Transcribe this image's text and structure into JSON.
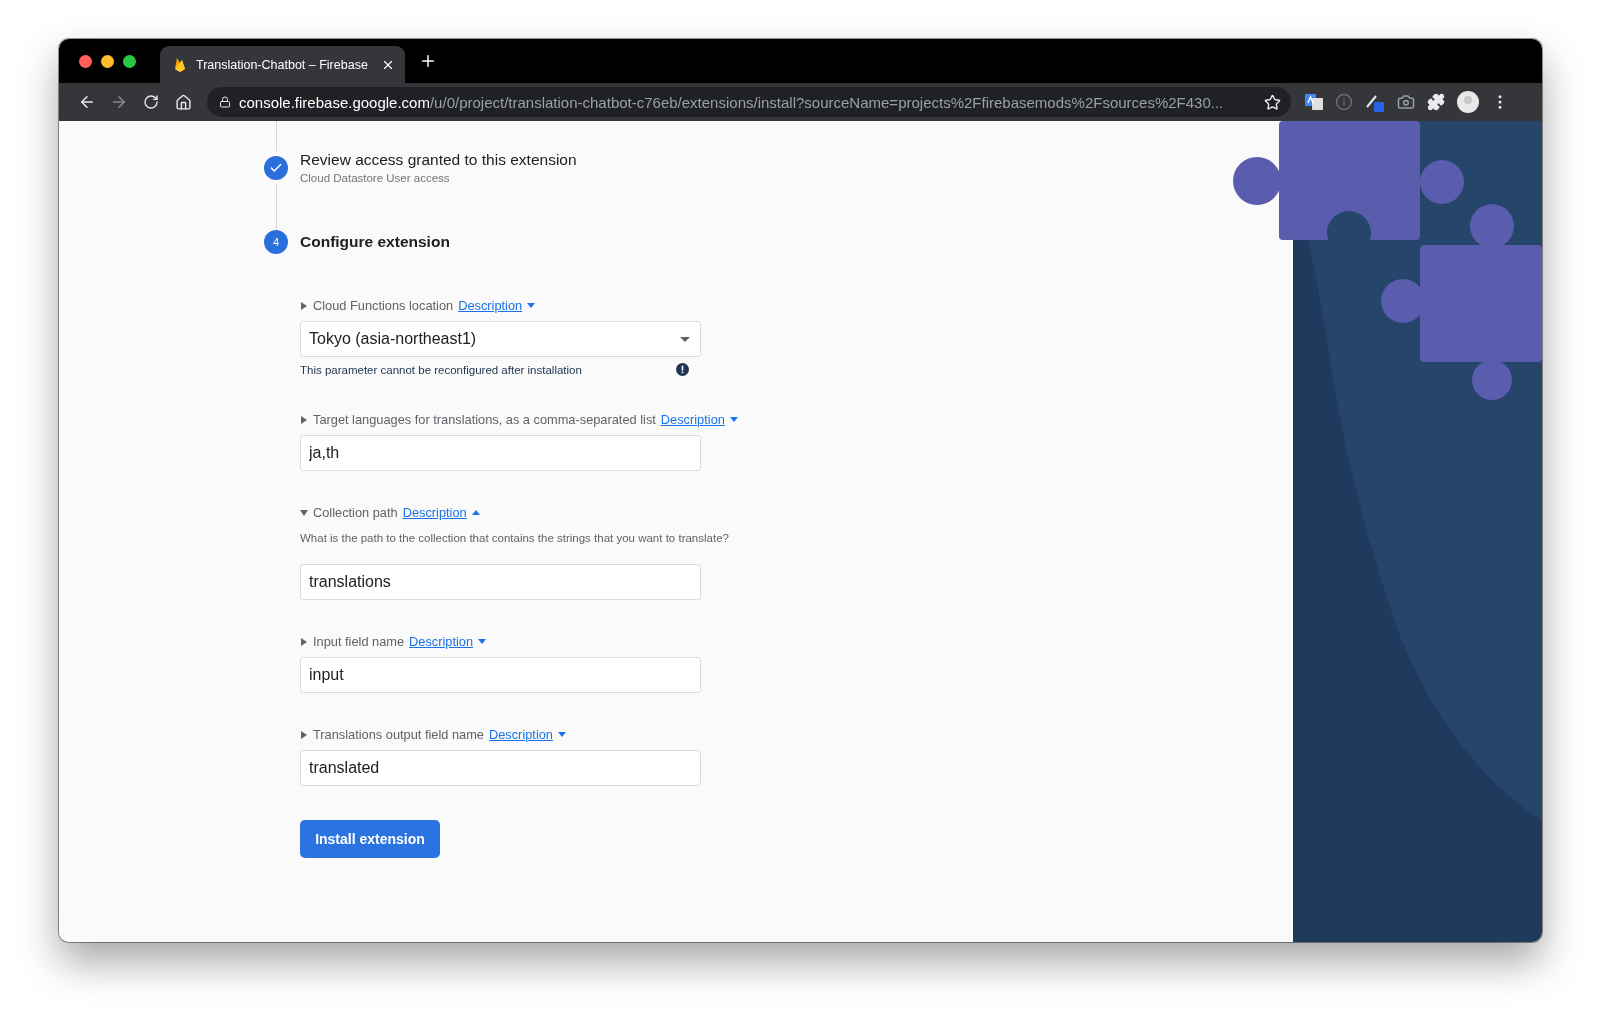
{
  "browser": {
    "tabs": [
      {
        "title": "Translation-Chatbot – Firebase",
        "selected": true
      }
    ],
    "nav": [
      {
        "kind": "back",
        "disabled": false
      },
      {
        "kind": "forward",
        "disabled": true
      },
      {
        "kind": "reload",
        "disabled": false
      },
      {
        "kind": "home",
        "disabled": false
      }
    ],
    "address": {
      "host": "console.firebase.google.com",
      "path": "/u/0/project/translation-chatbot-c76eb/extensions/install?sourceName=projects%2Ffirebasemods%2Fsources%2F430..."
    }
  },
  "steps": [
    {
      "completed": true,
      "title": "Review access granted to this extension",
      "subtitle": "Cloud Datastore User access"
    },
    {
      "completed": false,
      "number": "4",
      "title": "Configure extension"
    }
  ],
  "params": [
    {
      "kind": "select",
      "label": "Cloud Functions location",
      "link": "Description",
      "expanded": false,
      "value": "Tokyo (asia-northeast1)",
      "note": "This parameter cannot be reconfigured after installation"
    },
    {
      "kind": "text",
      "label": "Target languages for translations, as a comma-separated list",
      "link": "Description",
      "expanded": false,
      "value": "ja,th"
    },
    {
      "kind": "text",
      "label": "Collection path",
      "link": "Description",
      "expanded": true,
      "description": "What is the path to the collection that contains the strings that you want to translate?",
      "value": "translations"
    },
    {
      "kind": "text",
      "label": "Input field name",
      "link": "Description",
      "expanded": false,
      "value": "input"
    },
    {
      "kind": "text",
      "label": "Translations output field name",
      "link": "Description",
      "expanded": false,
      "value": "translated"
    }
  ],
  "install_button": "Install extension"
}
